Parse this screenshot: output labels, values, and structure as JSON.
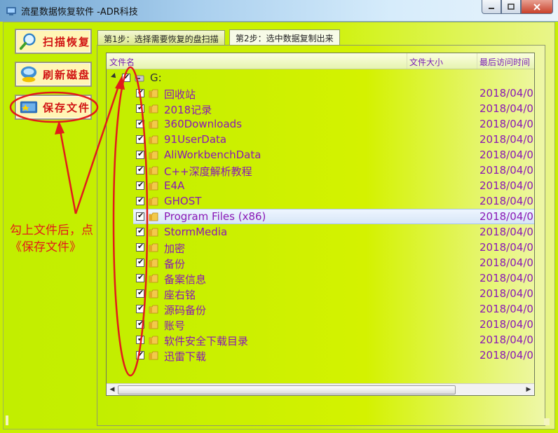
{
  "window": {
    "title": "流星数据恢复软件   -ADR科技",
    "controls": [
      "minimize-icon",
      "maximize-icon",
      "close-icon"
    ]
  },
  "sidebar": {
    "buttons": [
      {
        "label": "扫描恢复",
        "icon": "magnifier-icon"
      },
      {
        "label": "刷新磁盘",
        "icon": "refresh-disk-icon"
      },
      {
        "label": "保存文件",
        "icon": "save-card-icon"
      }
    ]
  },
  "tabs": [
    {
      "label": "第1步：选择需要恢复的盘扫描",
      "active": false
    },
    {
      "label": "第2步：选中数据复制出来",
      "active": true
    }
  ],
  "tree": {
    "columns": [
      "文件名",
      "文件大小",
      "最后访问时间"
    ],
    "root": {
      "label": "G:",
      "checked": true
    },
    "items": [
      {
        "name": "回收站",
        "date": "2018/04/0",
        "checked": true
      },
      {
        "name": "2018记录",
        "date": "2018/04/0",
        "checked": true
      },
      {
        "name": "360Downloads",
        "date": "2018/04/0",
        "checked": true
      },
      {
        "name": "91UserData",
        "date": "2018/04/0",
        "checked": true
      },
      {
        "name": "AliWorkbenchData",
        "date": "2018/04/0",
        "checked": true
      },
      {
        "name": "C++深度解析教程",
        "date": "2018/04/0",
        "checked": true
      },
      {
        "name": "E4A",
        "date": "2018/04/0",
        "checked": true
      },
      {
        "name": "GHOST",
        "date": "2018/04/0",
        "checked": true
      },
      {
        "name": "Program Files (x86)",
        "date": "2018/04/0",
        "checked": true,
        "highlighted": true
      },
      {
        "name": "StormMedia",
        "date": "2018/04/0",
        "checked": true
      },
      {
        "name": "加密",
        "date": "2018/04/0",
        "checked": true
      },
      {
        "name": "备份",
        "date": "2018/04/0",
        "checked": true
      },
      {
        "name": "备案信息",
        "date": "2018/04/0",
        "checked": true
      },
      {
        "name": "座右铭",
        "date": "2018/04/0",
        "checked": true
      },
      {
        "name": "源码备份",
        "date": "2018/04/0",
        "checked": true
      },
      {
        "name": "账号",
        "date": "2018/04/0",
        "checked": true
      },
      {
        "name": "软件安全下载目录",
        "date": "2018/04/0",
        "checked": true
      },
      {
        "name": "迅雷下载",
        "date": "2018/04/0",
        "checked": true
      }
    ]
  },
  "annotation": {
    "line1": "勾上文件后，点",
    "line2": "《保存文件》",
    "color": "#e21b1b"
  },
  "colors": {
    "accent_text": "#8a18b6",
    "button_text": "#d11313",
    "background": "#c9f000"
  }
}
